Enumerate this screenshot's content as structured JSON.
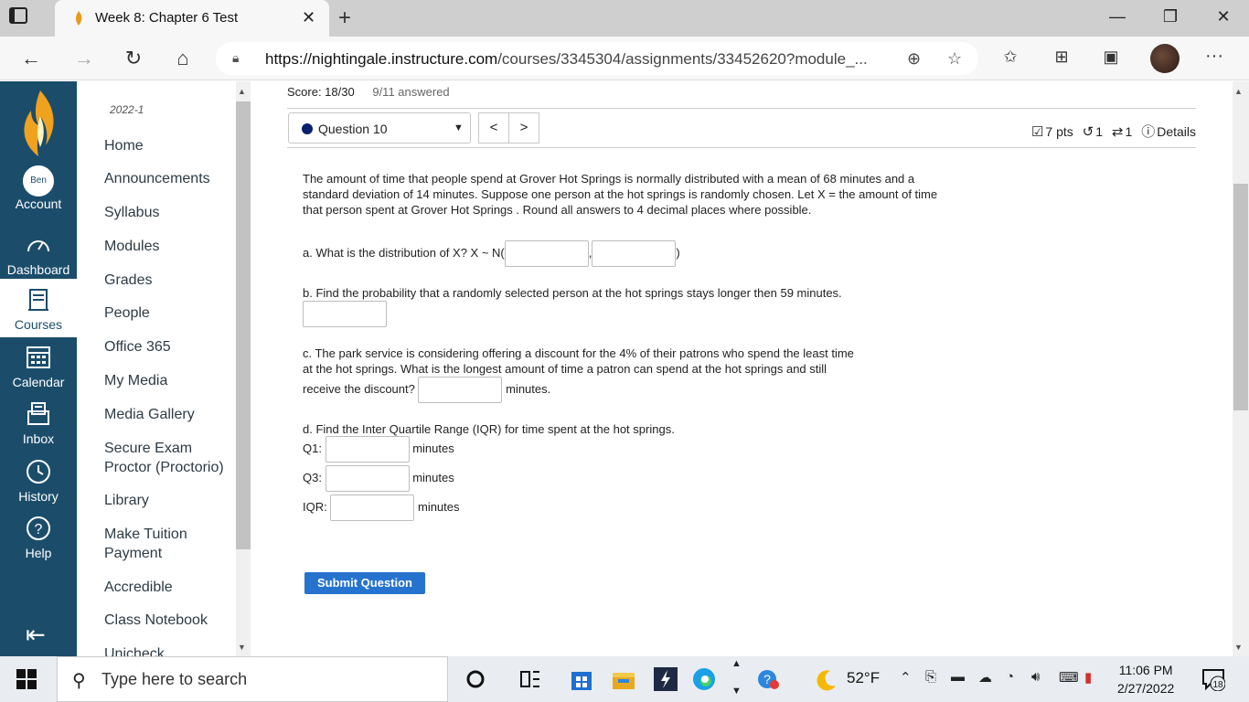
{
  "browser": {
    "tab_title": "Week 8: Chapter 6 Test",
    "tab_close": "✕",
    "new_tab": "+",
    "url_host": "https://nightingale.instructure.com",
    "url_path": "/courses/3345304/assignments/33452620?module_..."
  },
  "global_nav": {
    "account": "Account",
    "account_avatar": "Ben",
    "dashboard": "Dashboard",
    "courses": "Courses",
    "calendar": "Calendar",
    "inbox": "Inbox",
    "history": "History",
    "help": "Help",
    "active": "Courses"
  },
  "course_nav": {
    "term": "2022-1",
    "links": [
      "Home",
      "Announcements",
      "Syllabus",
      "Modules",
      "Grades",
      "People",
      "Office 365",
      "My Media",
      "Media Gallery",
      "Secure Exam Proctor (Proctorio)",
      "Library",
      "Make Tuition Payment",
      "Accredible",
      "Class Notebook",
      "Unicheck"
    ]
  },
  "quiz": {
    "score": "Score: 18/30",
    "answered": "9/11 answered",
    "question_select": "Question 10",
    "prev": "<",
    "next": ">",
    "points": "7 pts",
    "retries": "1",
    "attempts": "1",
    "details": "Details",
    "prompt": "The amount of time that people spend at Grover Hot Springs is normally distributed with a mean of 68 minutes and a standard deviation of 14 minutes. Suppose one person at the hot springs is randomly chosen. Let X = the amount of time that person spent at Grover Hot Springs . Round all answers to 4 decimal places where possible.",
    "part_a": "a. What is the distribution of X? X ~ N(",
    "part_a_sep": ",",
    "part_a_end": ")",
    "part_b": "b. Find the probability that a randomly selected person at the hot springs stays longer then 59 minutes.",
    "part_c_line1": "c. The park service is considering offering a discount for the 4% of their patrons who spend the least time",
    "part_c_line2": "at the hot springs. What is the longest amount of time a patron can spend at the hot springs and still",
    "part_c_line3": "receive the discount?",
    "part_c_unit": "minutes.",
    "part_d": "d. Find the Inter Quartile Range (IQR) for time spent at the hot springs.",
    "q1_label": "Q1:",
    "q3_label": "Q3:",
    "iqr_label": "IQR:",
    "minutes": "minutes",
    "submit": "Submit Question"
  },
  "taskbar": {
    "search_placeholder": "Type here to search",
    "temperature": "52°F",
    "time": "11:06 PM",
    "date": "2/27/2022",
    "notifications": "18"
  },
  "colors": {
    "global_nav_bg": "#1b4d6b",
    "submit_bg": "#2673cf",
    "question_dot": "#0a1f6e"
  }
}
